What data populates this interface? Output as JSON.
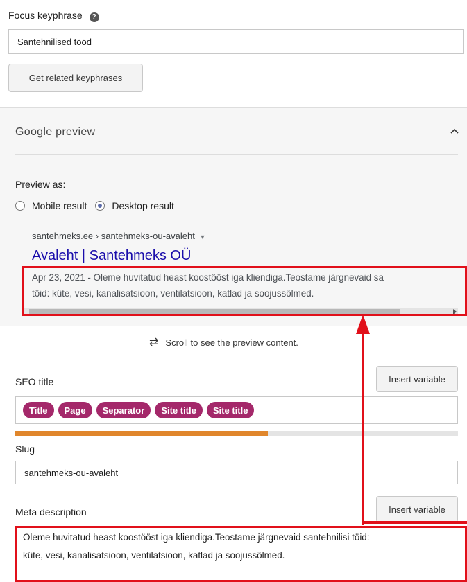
{
  "focus": {
    "label": "Focus keyphrase",
    "help": "?",
    "value": "Santehnilised tööd",
    "related_button": "Get related keyphrases"
  },
  "google_preview": {
    "title": "Google preview",
    "preview_as": "Preview as:",
    "mobile_label": "Mobile result",
    "desktop_label": "Desktop result",
    "selected": "desktop",
    "breadcrumb": "santehmeks.ee › santehmeks-ou-avaleht",
    "result_title": "Avaleht | Santehmeks OÜ",
    "snippet_line1": "Apr 23, 2021 - Oleme huvitatud heast koostööst iga kliendiga.Teostame järgnevaid sa",
    "snippet_line2": "töid: küte, vesi, kanalisatsioon, ventilatsioon, katlad ja soojussõlmed.",
    "scroll_hint": "Scroll to see the preview content."
  },
  "seo_title": {
    "label": "SEO title",
    "insert_button": "Insert variable",
    "pills": [
      "Title",
      "Page",
      "Separator",
      "Site title",
      "Site title"
    ],
    "progress": 0.57
  },
  "slug": {
    "label": "Slug",
    "value": "santehmeks-ou-avaleht"
  },
  "meta_description": {
    "label": "Meta description",
    "insert_button": "Insert variable",
    "line1": "Oleme huvitatud heast koostööst iga kliendiga.Teostame järgnevaid santehnilisi töid:",
    "line2": "küte, vesi, kanalisatsioon, ventilatsioon, katlad ja soojussõlmed."
  },
  "colors": {
    "pill": "#a4286a",
    "link": "#1a0dab",
    "highlight": "#e1101a",
    "progress": "#e0862c"
  }
}
